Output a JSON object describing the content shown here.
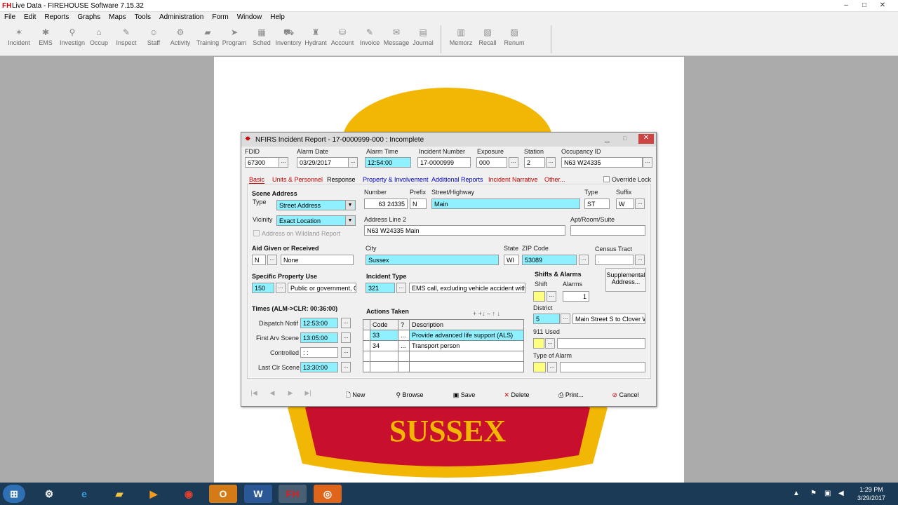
{
  "window": {
    "logo": "FH",
    "title": "Live Data - FIREHOUSE Software 7.15.32"
  },
  "menu": [
    "File",
    "Edit",
    "Reports",
    "Graphs",
    "Maps",
    "Tools",
    "Administration",
    "Form",
    "Window",
    "Help"
  ],
  "toolbar": [
    "Incident",
    "EMS",
    "Investign",
    "Occup",
    "Inspect",
    "Staff",
    "Activity",
    "Training",
    "Program",
    "Sched",
    "Inventory",
    "Hydrant",
    "Account",
    "Invoice",
    "Message",
    "Journal",
    "Memorz",
    "Recall",
    "Renum"
  ],
  "background_text": "SUSSEX",
  "dialog": {
    "title": "NFIRS Incident Report - 17-0000999-000  : Incomplete",
    "header": {
      "fdid_label": "FDID",
      "fdid": "67300",
      "alarm_date_label": "Alarm Date",
      "alarm_date": "03/29/2017",
      "alarm_time_label": "Alarm Time",
      "alarm_time": "12:54:00",
      "incident_number_label": "Incident Number",
      "incident_number": "17-0000999",
      "exposure_label": "Exposure",
      "exposure": "000",
      "station_label": "Station",
      "station": "2",
      "occupancy_label": "Occupancy ID",
      "occupancy": "N63 W24335"
    },
    "tabs": [
      "Basic",
      "Units & Personnel",
      "Response",
      "Property & Involvement",
      "Additional Reports",
      "Incident Narrative",
      "Other..."
    ],
    "override_lock": "Override Lock",
    "scene": {
      "title": "Scene Address",
      "type_label": "Type",
      "type": "Street Address",
      "vicinity_label": "Vicinity",
      "vicinity": "Exact Location",
      "wildland": "Address on Wildland Report",
      "number_label": "Number",
      "number": "63 24335",
      "prefix_label": "Prefix",
      "prefix": "N",
      "street_label": "Street/Highway",
      "street": "Main",
      "stype_label": "Type",
      "stype": "ST",
      "suffix_label": "Suffix",
      "suffix": "W",
      "addr2_label": "Address Line 2",
      "addr2": "N63 W24335 Main",
      "apt_label": "Apt/Room/Suite",
      "apt": "",
      "city_label": "City",
      "city": "Sussex",
      "state_label": "State",
      "state": "WI",
      "zip_label": "ZIP Code",
      "zip": "53089",
      "census_label": "Census Tract",
      "census": "."
    },
    "aid": {
      "title": "Aid Given or Received",
      "code": "N",
      "desc": "None"
    },
    "property": {
      "title": "Specific Property Use",
      "code": "150",
      "desc": "Public or government, Ot"
    },
    "incident_type": {
      "title": "Incident Type",
      "code": "321",
      "desc": "EMS call, excluding vehicle accident with"
    },
    "shifts": {
      "title": "Shifts & Alarms",
      "shift_label": "Shift",
      "alarms_label": "Alarms",
      "alarms": "1",
      "supplemental": "Supplemental Address...",
      "district_label": "District",
      "district": "5",
      "district_desc": "Main Street S to Clover W",
      "used911_label": "911 Used",
      "type_alarm_label": "Type of Alarm"
    },
    "times": {
      "title": "Times (ALM->CLR: 00:36:00)",
      "rows": [
        {
          "label": "Dispatch Notif",
          "value": "12:53:00"
        },
        {
          "label": "First Arv Scene",
          "value": "13:05:00"
        },
        {
          "label": "Controlled",
          "value": " : : "
        },
        {
          "label": "Last Clr Scene",
          "value": "13:30:00"
        }
      ]
    },
    "actions": {
      "title": "Actions Taken",
      "tools": "+ +↓ – ↑ ↓",
      "cols": [
        "Code",
        "?",
        "Description"
      ],
      "rows": [
        {
          "code": "33",
          "desc": "Provide advanced life support (ALS)"
        },
        {
          "code": "34",
          "desc": "Transport person"
        }
      ]
    },
    "buttons": {
      "new": "New",
      "browse": "Browse",
      "save": "Save",
      "delete": "Delete",
      "print": "Print...",
      "cancel": "Cancel"
    }
  },
  "taskbar": {
    "clock_time": "1:29 PM",
    "clock_date": "3/29/2017",
    "apps": [
      "O",
      "W",
      "FH"
    ]
  }
}
